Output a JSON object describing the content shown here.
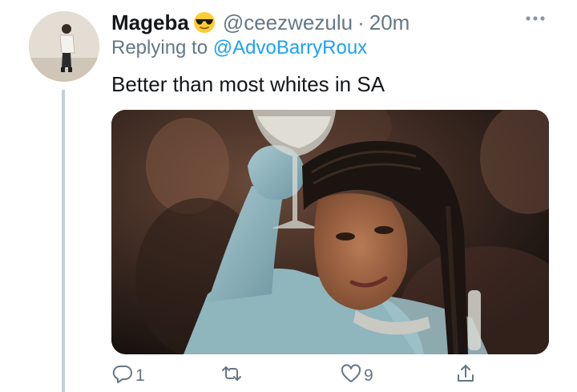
{
  "tweet": {
    "display_name": "Mageba",
    "emoji": "sunglasses-emoji",
    "handle": "@ceezwezulu",
    "separator": "·",
    "time": "20m",
    "replying_prefix": "Replying to ",
    "replying_to": "@AdvoBarryRoux",
    "text": "Better than most whites in SA",
    "media": "photo-woman-raising-glass",
    "more_icon": "more-horizontal-icon"
  },
  "actions": {
    "reply": {
      "icon": "reply-icon",
      "count": "1"
    },
    "retweet": {
      "icon": "retweet-icon",
      "count": ""
    },
    "like": {
      "icon": "heart-icon",
      "count": "9"
    },
    "share": {
      "icon": "share-icon",
      "count": ""
    }
  },
  "colors": {
    "text": "#14171a",
    "secondary": "#657786",
    "link": "#1da1f2",
    "thread_line": "#c4cfd6"
  }
}
